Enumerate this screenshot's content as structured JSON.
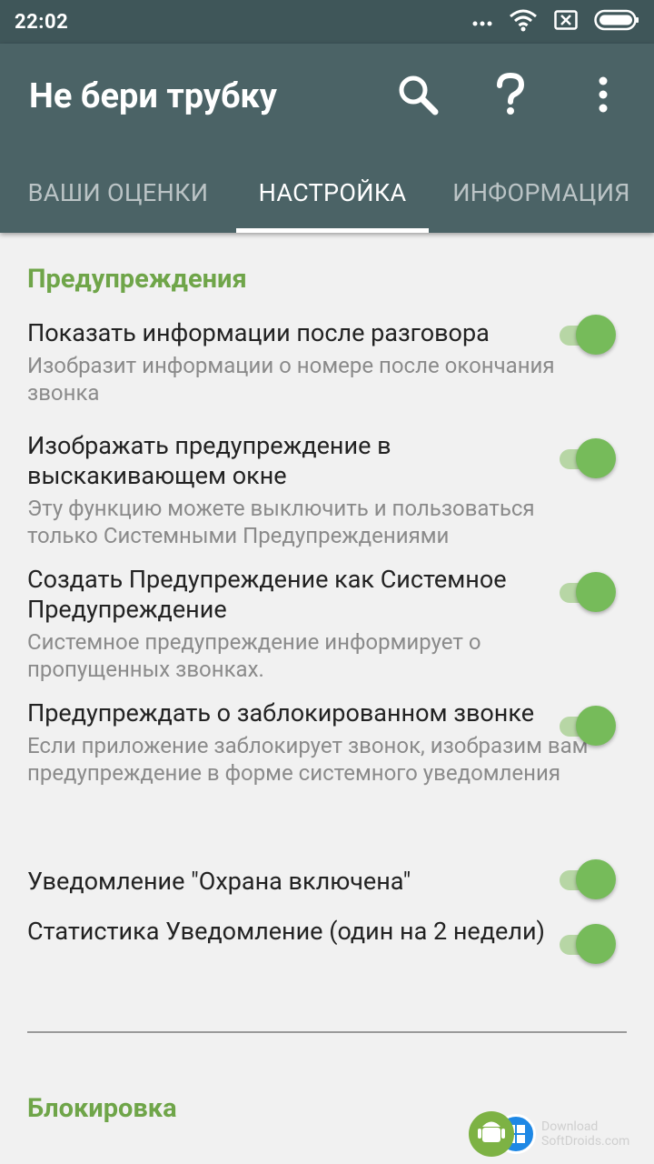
{
  "status_bar": {
    "time": "22:02",
    "icons": [
      "dots-icon",
      "wifi-icon",
      "sim-icon",
      "battery-icon"
    ]
  },
  "app_bar": {
    "title": "Не бери трубку",
    "actions": [
      "search-icon",
      "help-icon",
      "overflow-menu-icon"
    ]
  },
  "tabs": [
    {
      "label": "ВАШИ ОЦЕНКИ",
      "active": false
    },
    {
      "label": "НАСТРОЙКА",
      "active": true
    },
    {
      "label": "ИНФОРМАЦИЯ",
      "active": false
    }
  ],
  "sections": [
    {
      "title": "Предупреждения",
      "items": [
        {
          "title": "Показать информации после разговора",
          "summary": "Изобразит информации о номере после окончания звонка",
          "enabled": true
        },
        {
          "title": "Изображать предупреждение в выскакивающем окне",
          "summary": "Эту функцию можете выключить и пользоваться только Системными Предупреждениями",
          "enabled": true
        },
        {
          "title": "Создать Предупреждение как Системное Предупреждение",
          "summary": "Системное предупреждение информирует о пропущенных звонках.",
          "enabled": true
        },
        {
          "title": "Предупреждать о заблокированном звонке",
          "summary": "Если приложение заблокирует звонок, изобразим вам предупреждение в форме системного уведомления",
          "enabled": true
        },
        {
          "title": "Уведомление \"Охрана включена\"",
          "summary": "",
          "enabled": true
        },
        {
          "title": "Статистика Уведомление (один на 2 недели)",
          "summary": "",
          "enabled": true
        }
      ]
    },
    {
      "title": "Блокировка",
      "items": []
    }
  ],
  "watermark": {
    "line1": "Download",
    "line2": "SoftDroids.com"
  },
  "colors": {
    "status_bar": "#3f5659",
    "app_bar": "#4b6366",
    "accent_green": "#6fa549",
    "switch_thumb": "#76bb5a",
    "switch_track": "#b7d6a5",
    "background": "#f1f1f1"
  }
}
